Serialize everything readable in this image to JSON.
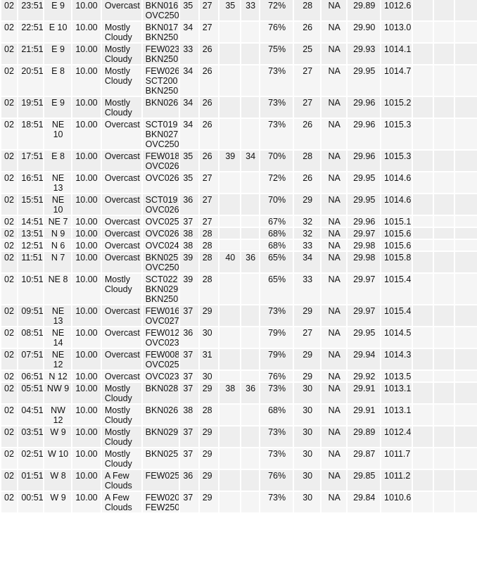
{
  "table": {
    "rows": [
      {
        "date": "02",
        "time": "23:51",
        "wind": "E 9",
        "vis": "10.00",
        "weather": "Overcast",
        "sky": "BKN016 OVC250",
        "air": "35",
        "dwpt": "27",
        "max6": "35",
        "min6": "33",
        "rh": "72%",
        "windchill": "28",
        "heat": "NA",
        "alt": "29.89",
        "slp": "1012.6",
        "p1": "",
        "p3": "",
        "p6": ""
      },
      {
        "date": "02",
        "time": "22:51",
        "wind": "E 10",
        "vis": "10.00",
        "weather": "Mostly Cloudy",
        "sky": "BKN017 BKN250",
        "air": "34",
        "dwpt": "27",
        "max6": "",
        "min6": "",
        "rh": "76%",
        "windchill": "26",
        "heat": "NA",
        "alt": "29.90",
        "slp": "1013.0",
        "p1": "",
        "p3": "",
        "p6": ""
      },
      {
        "date": "02",
        "time": "21:51",
        "wind": "E 9",
        "vis": "10.00",
        "weather": "Mostly Cloudy",
        "sky": "FEW023 BKN250",
        "air": "33",
        "dwpt": "26",
        "max6": "",
        "min6": "",
        "rh": "75%",
        "windchill": "25",
        "heat": "NA",
        "alt": "29.93",
        "slp": "1014.1",
        "p1": "",
        "p3": "",
        "p6": ""
      },
      {
        "date": "02",
        "time": "20:51",
        "wind": "E 8",
        "vis": "10.00",
        "weather": "Mostly Cloudy",
        "sky": "FEW026 SCT200 BKN250",
        "air": "34",
        "dwpt": "26",
        "max6": "",
        "min6": "",
        "rh": "73%",
        "windchill": "27",
        "heat": "NA",
        "alt": "29.95",
        "slp": "1014.7",
        "p1": "",
        "p3": "",
        "p6": ""
      },
      {
        "date": "02",
        "time": "19:51",
        "wind": "E 9",
        "vis": "10.00",
        "weather": "Mostly Cloudy",
        "sky": "BKN026",
        "air": "34",
        "dwpt": "26",
        "max6": "",
        "min6": "",
        "rh": "73%",
        "windchill": "27",
        "heat": "NA",
        "alt": "29.96",
        "slp": "1015.2",
        "p1": "",
        "p3": "",
        "p6": ""
      },
      {
        "date": "02",
        "time": "18:51",
        "wind": "NE 10",
        "vis": "10.00",
        "weather": "Overcast",
        "sky": "SCT019 BKN027 OVC250",
        "air": "34",
        "dwpt": "26",
        "max6": "",
        "min6": "",
        "rh": "73%",
        "windchill": "26",
        "heat": "NA",
        "alt": "29.96",
        "slp": "1015.3",
        "p1": "",
        "p3": "",
        "p6": ""
      },
      {
        "date": "02",
        "time": "17:51",
        "wind": "E 8",
        "vis": "10.00",
        "weather": "Overcast",
        "sky": "FEW018 OVC026",
        "air": "35",
        "dwpt": "26",
        "max6": "39",
        "min6": "34",
        "rh": "70%",
        "windchill": "28",
        "heat": "NA",
        "alt": "29.96",
        "slp": "1015.3",
        "p1": "",
        "p3": "",
        "p6": ""
      },
      {
        "date": "02",
        "time": "16:51",
        "wind": "NE 13",
        "vis": "10.00",
        "weather": "Overcast",
        "sky": "OVC026",
        "air": "35",
        "dwpt": "27",
        "max6": "",
        "min6": "",
        "rh": "72%",
        "windchill": "26",
        "heat": "NA",
        "alt": "29.95",
        "slp": "1014.6",
        "p1": "",
        "p3": "",
        "p6": ""
      },
      {
        "date": "02",
        "time": "15:51",
        "wind": "NE 10",
        "vis": "10.00",
        "weather": "Overcast",
        "sky": "SCT019 OVC026",
        "air": "36",
        "dwpt": "27",
        "max6": "",
        "min6": "",
        "rh": "70%",
        "windchill": "29",
        "heat": "NA",
        "alt": "29.95",
        "slp": "1014.6",
        "p1": "",
        "p3": "",
        "p6": ""
      },
      {
        "date": "02",
        "time": "14:51",
        "wind": "NE 7",
        "vis": "10.00",
        "weather": "Overcast",
        "sky": "OVC025",
        "air": "37",
        "dwpt": "27",
        "max6": "",
        "min6": "",
        "rh": "67%",
        "windchill": "32",
        "heat": "NA",
        "alt": "29.96",
        "slp": "1015.1",
        "p1": "",
        "p3": "",
        "p6": ""
      },
      {
        "date": "02",
        "time": "13:51",
        "wind": "N 9",
        "vis": "10.00",
        "weather": "Overcast",
        "sky": "OVC026",
        "air": "38",
        "dwpt": "28",
        "max6": "",
        "min6": "",
        "rh": "68%",
        "windchill": "32",
        "heat": "NA",
        "alt": "29.97",
        "slp": "1015.6",
        "p1": "",
        "p3": "",
        "p6": ""
      },
      {
        "date": "02",
        "time": "12:51",
        "wind": "N 6",
        "vis": "10.00",
        "weather": "Overcast",
        "sky": "OVC024",
        "air": "38",
        "dwpt": "28",
        "max6": "",
        "min6": "",
        "rh": "68%",
        "windchill": "33",
        "heat": "NA",
        "alt": "29.98",
        "slp": "1015.6",
        "p1": "",
        "p3": "",
        "p6": ""
      },
      {
        "date": "02",
        "time": "11:51",
        "wind": "N 7",
        "vis": "10.00",
        "weather": "Overcast",
        "sky": "BKN025 OVC250",
        "air": "39",
        "dwpt": "28",
        "max6": "40",
        "min6": "36",
        "rh": "65%",
        "windchill": "34",
        "heat": "NA",
        "alt": "29.98",
        "slp": "1015.8",
        "p1": "",
        "p3": "",
        "p6": ""
      },
      {
        "date": "02",
        "time": "10:51",
        "wind": "NE 8",
        "vis": "10.00",
        "weather": "Mostly Cloudy",
        "sky": "SCT022 BKN029 BKN250",
        "air": "39",
        "dwpt": "28",
        "max6": "",
        "min6": "",
        "rh": "65%",
        "windchill": "33",
        "heat": "NA",
        "alt": "29.97",
        "slp": "1015.4",
        "p1": "",
        "p3": "",
        "p6": ""
      },
      {
        "date": "02",
        "time": "09:51",
        "wind": "NE 13",
        "vis": "10.00",
        "weather": "Overcast",
        "sky": "FEW016 OVC027",
        "air": "37",
        "dwpt": "29",
        "max6": "",
        "min6": "",
        "rh": "73%",
        "windchill": "29",
        "heat": "NA",
        "alt": "29.97",
        "slp": "1015.4",
        "p1": "",
        "p3": "",
        "p6": ""
      },
      {
        "date": "02",
        "time": "08:51",
        "wind": "NE 14",
        "vis": "10.00",
        "weather": "Overcast",
        "sky": "FEW012 OVC023",
        "air": "36",
        "dwpt": "30",
        "max6": "",
        "min6": "",
        "rh": "79%",
        "windchill": "27",
        "heat": "NA",
        "alt": "29.95",
        "slp": "1014.5",
        "p1": "",
        "p3": "",
        "p6": ""
      },
      {
        "date": "02",
        "time": "07:51",
        "wind": "NE 12",
        "vis": "10.00",
        "weather": "Overcast",
        "sky": "FEW008 OVC025",
        "air": "37",
        "dwpt": "31",
        "max6": "",
        "min6": "",
        "rh": "79%",
        "windchill": "29",
        "heat": "NA",
        "alt": "29.94",
        "slp": "1014.3",
        "p1": "",
        "p3": "",
        "p6": ""
      },
      {
        "date": "02",
        "time": "06:51",
        "wind": "N 12",
        "vis": "10.00",
        "weather": "Overcast",
        "sky": "OVC023",
        "air": "37",
        "dwpt": "30",
        "max6": "",
        "min6": "",
        "rh": "76%",
        "windchill": "29",
        "heat": "NA",
        "alt": "29.92",
        "slp": "1013.5",
        "p1": "",
        "p3": "",
        "p6": ""
      },
      {
        "date": "02",
        "time": "05:51",
        "wind": "NW 9",
        "vis": "10.00",
        "weather": "Mostly Cloudy",
        "sky": "BKN028",
        "air": "37",
        "dwpt": "29",
        "max6": "38",
        "min6": "36",
        "rh": "73%",
        "windchill": "30",
        "heat": "NA",
        "alt": "29.91",
        "slp": "1013.1",
        "p1": "",
        "p3": "",
        "p6": ""
      },
      {
        "date": "02",
        "time": "04:51",
        "wind": "NW 12",
        "vis": "10.00",
        "weather": "Mostly Cloudy",
        "sky": "BKN026",
        "air": "38",
        "dwpt": "28",
        "max6": "",
        "min6": "",
        "rh": "68%",
        "windchill": "30",
        "heat": "NA",
        "alt": "29.91",
        "slp": "1013.1",
        "p1": "",
        "p3": "",
        "p6": ""
      },
      {
        "date": "02",
        "time": "03:51",
        "wind": "W 9",
        "vis": "10.00",
        "weather": "Mostly Cloudy",
        "sky": "BKN029",
        "air": "37",
        "dwpt": "29",
        "max6": "",
        "min6": "",
        "rh": "73%",
        "windchill": "30",
        "heat": "NA",
        "alt": "29.89",
        "slp": "1012.4",
        "p1": "",
        "p3": "",
        "p6": ""
      },
      {
        "date": "02",
        "time": "02:51",
        "wind": "W 10",
        "vis": "10.00",
        "weather": "Mostly Cloudy",
        "sky": "BKN025",
        "air": "37",
        "dwpt": "29",
        "max6": "",
        "min6": "",
        "rh": "73%",
        "windchill": "30",
        "heat": "NA",
        "alt": "29.87",
        "slp": "1011.7",
        "p1": "",
        "p3": "",
        "p6": ""
      },
      {
        "date": "02",
        "time": "01:51",
        "wind": "W 8",
        "vis": "10.00",
        "weather": "A Few Clouds",
        "sky": "FEW025",
        "air": "36",
        "dwpt": "29",
        "max6": "",
        "min6": "",
        "rh": "76%",
        "windchill": "30",
        "heat": "NA",
        "alt": "29.85",
        "slp": "1011.2",
        "p1": "",
        "p3": "",
        "p6": ""
      },
      {
        "date": "02",
        "time": "00:51",
        "wind": "W 9",
        "vis": "10.00",
        "weather": "A Few Clouds",
        "sky": "FEW020 FEW250",
        "air": "37",
        "dwpt": "29",
        "max6": "",
        "min6": "",
        "rh": "73%",
        "windchill": "30",
        "heat": "NA",
        "alt": "29.84",
        "slp": "1010.6",
        "p1": "",
        "p3": "",
        "p6": ""
      }
    ]
  }
}
